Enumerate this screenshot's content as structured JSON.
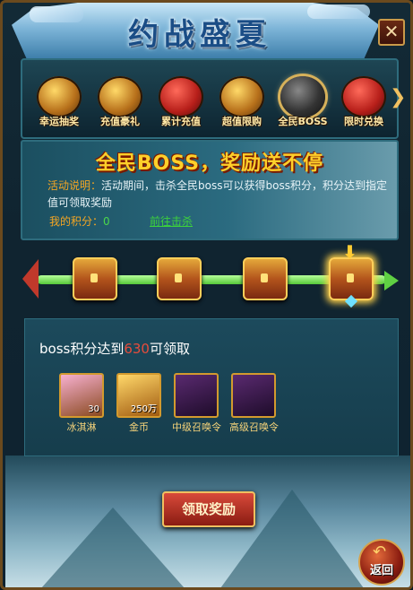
{
  "title": "约战盛夏",
  "close_label": "✕",
  "tabs": [
    {
      "label": "幸运抽奖",
      "icon": "lucky-draw-icon"
    },
    {
      "label": "充值豪礼",
      "icon": "recharge-gift-icon"
    },
    {
      "label": "累计充值",
      "icon": "accumulate-recharge-icon"
    },
    {
      "label": "超值限购",
      "icon": "limited-purchase-icon"
    },
    {
      "label": "全民BOSS",
      "icon": "boss-icon",
      "active": true
    },
    {
      "label": "限时兑换",
      "icon": "limited-exchange-icon"
    }
  ],
  "info": {
    "title": "全民BOSS，奖励送不停",
    "desc_key": "活动说明：",
    "desc_text": "活动期间，击杀全民boss可以获得boss积分，积分达到指定值可领取奖励",
    "score_key": "我的积分：",
    "score_value": "0",
    "goto_label": "前往击杀"
  },
  "progress": {
    "stages": 4,
    "selected_index": 3
  },
  "reward": {
    "req_prefix": "boss积分达到",
    "req_value": "630",
    "req_suffix": "可领取",
    "items": [
      {
        "name": "冰淇淋",
        "count": "30",
        "icon": "ice-cream-icon"
      },
      {
        "name": "金币",
        "count": "250万",
        "icon": "gold-coin-icon"
      },
      {
        "name": "中级召唤令",
        "count": "",
        "icon": "mid-summon-token-icon"
      },
      {
        "name": "高级召唤令",
        "count": "",
        "icon": "high-summon-token-icon"
      }
    ]
  },
  "claim_label": "领取奖励",
  "back_label": "返回"
}
